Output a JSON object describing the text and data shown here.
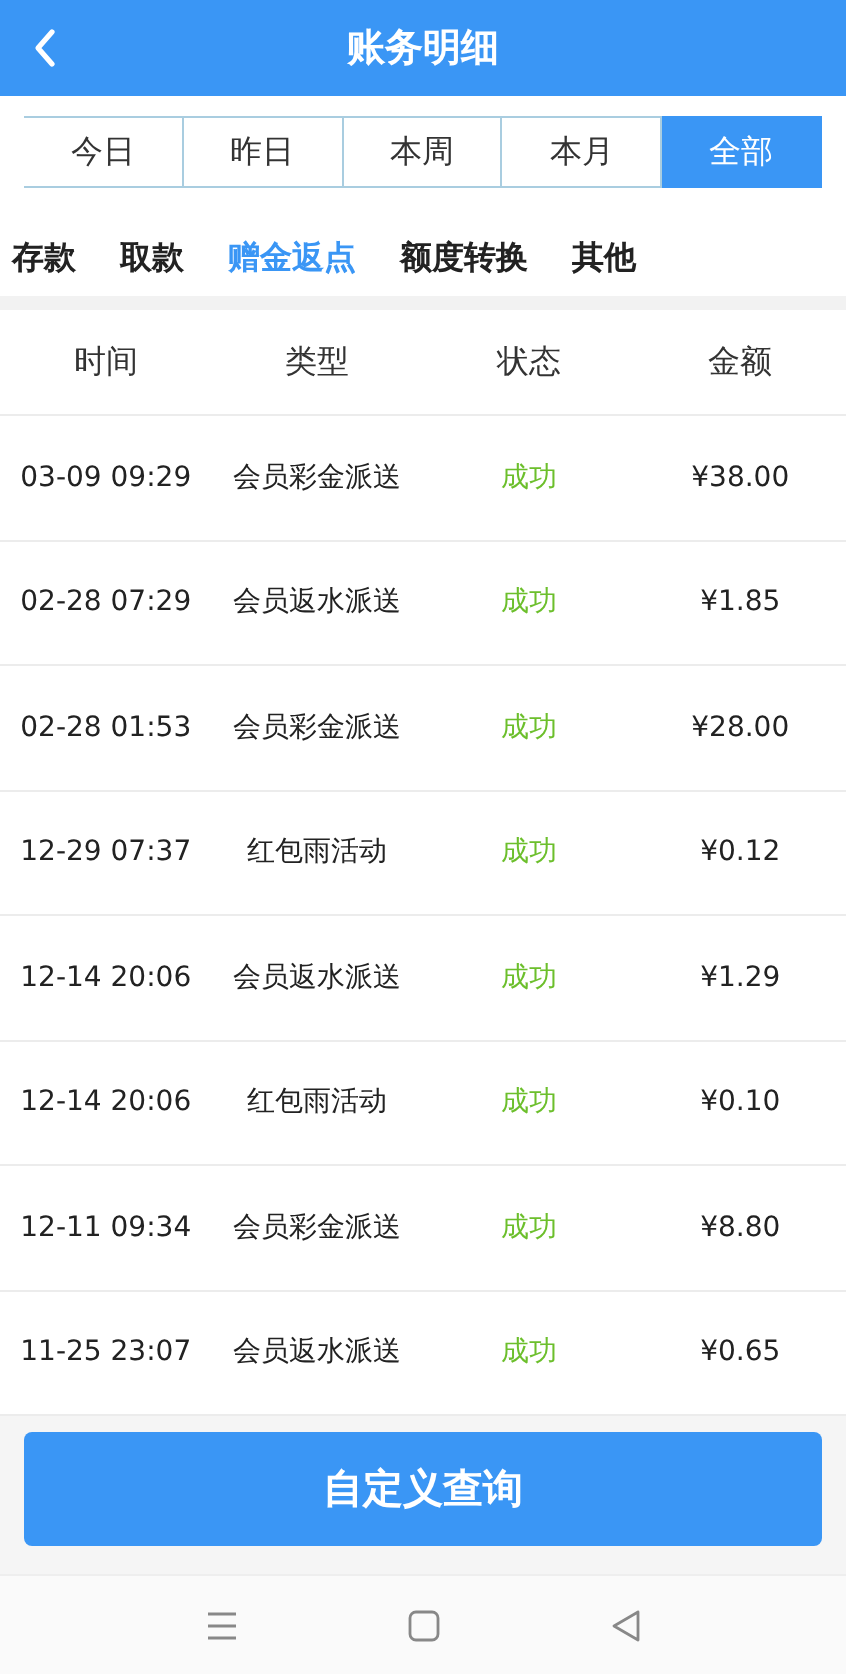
{
  "header": {
    "title": "账务明细"
  },
  "periods": [
    {
      "label": "今日",
      "selected": false
    },
    {
      "label": "昨日",
      "selected": false
    },
    {
      "label": "本周",
      "selected": false
    },
    {
      "label": "本月",
      "selected": false
    },
    {
      "label": "全部",
      "selected": true
    }
  ],
  "categories": [
    {
      "label": "存款",
      "selected": false
    },
    {
      "label": "取款",
      "selected": false
    },
    {
      "label": "赠金返点",
      "selected": true
    },
    {
      "label": "额度转换",
      "selected": false
    },
    {
      "label": "其他",
      "selected": false
    }
  ],
  "table": {
    "columns": [
      "时间",
      "类型",
      "状态",
      "金额"
    ],
    "rows": [
      {
        "time": "03-09 09:29",
        "type": "会员彩金派送",
        "status": "成功",
        "amount": "¥38.00"
      },
      {
        "time": "02-28 07:29",
        "type": "会员返水派送",
        "status": "成功",
        "amount": "¥1.85"
      },
      {
        "time": "02-28 01:53",
        "type": "会员彩金派送",
        "status": "成功",
        "amount": "¥28.00"
      },
      {
        "time": "12-29 07:37",
        "type": "红包雨活动",
        "status": "成功",
        "amount": "¥0.12"
      },
      {
        "time": "12-14 20:06",
        "type": "会员返水派送",
        "status": "成功",
        "amount": "¥1.29"
      },
      {
        "time": "12-14 20:06",
        "type": "红包雨活动",
        "status": "成功",
        "amount": "¥0.10"
      },
      {
        "time": "12-11 09:34",
        "type": "会员彩金派送",
        "status": "成功",
        "amount": "¥8.80"
      },
      {
        "time": "11-25 23:07",
        "type": "会员返水派送",
        "status": "成功",
        "amount": "¥0.65"
      }
    ]
  },
  "query_button": {
    "label": "自定义查询"
  }
}
